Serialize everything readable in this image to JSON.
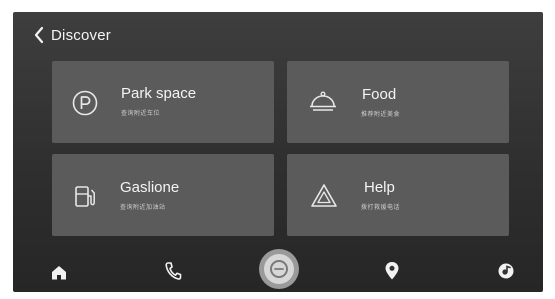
{
  "header": {
    "title": "Discover",
    "back_icon": "chevron-left-icon"
  },
  "tiles": [
    {
      "label": "Park space",
      "sublabel": "查询附近车位",
      "icon": "parking-icon"
    },
    {
      "label": "Food",
      "sublabel": "推荐附近美食",
      "icon": "food-cloche-icon"
    },
    {
      "label": "Gaslione",
      "sublabel": "查询附近加油站",
      "icon": "fuel-pump-icon"
    },
    {
      "label": "Help",
      "sublabel": "拨打救援电话",
      "icon": "warning-triangle-icon"
    }
  ],
  "dock": {
    "items": [
      "home-icon",
      "phone-icon",
      "voice-assistant-icon",
      "map-pin-icon",
      "music-icon"
    ]
  },
  "colors": {
    "tile": "#5b5b5b",
    "screen": "#333333",
    "text": "#f4f4f4"
  }
}
